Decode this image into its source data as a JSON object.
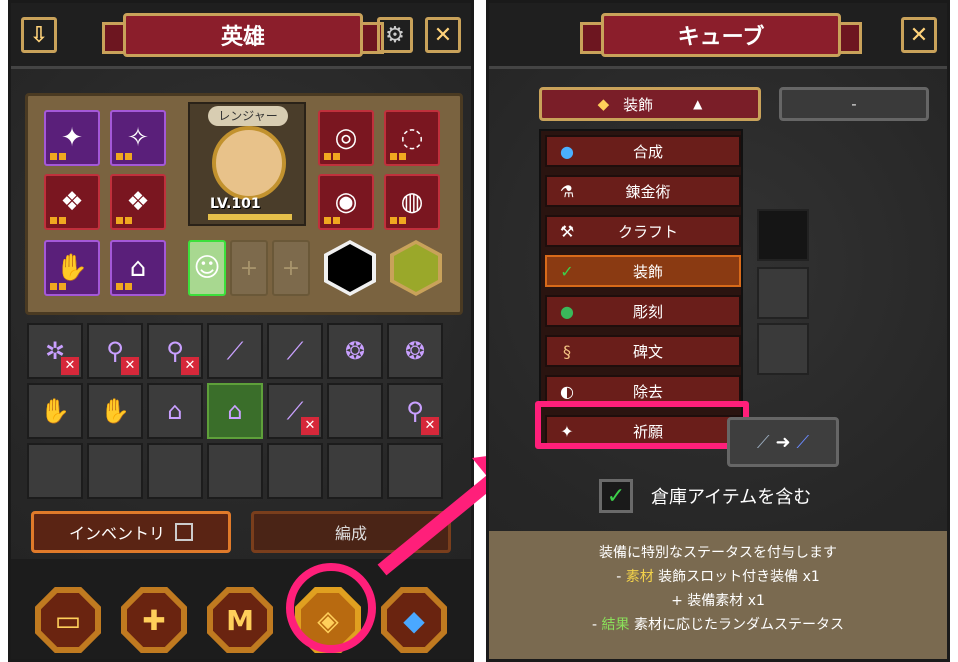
{
  "left_panel": {
    "title": "英雄",
    "hero": {
      "class_label": "レンジャー",
      "level": "LV.101"
    },
    "tabs": {
      "inventory": "インベントリ",
      "formation": "編成"
    },
    "bottom_nav": [
      {
        "id": "chest",
        "icon": "chest-icon",
        "glyph": "▭"
      },
      {
        "id": "cross",
        "icon": "cross-icon",
        "glyph": "✚"
      },
      {
        "id": "rune",
        "icon": "rune-icon",
        "glyph": "M"
      },
      {
        "id": "cube",
        "icon": "cube-icon",
        "glyph": "◈"
      },
      {
        "id": "gem",
        "icon": "gem-icon",
        "glyph": "◆"
      }
    ]
  },
  "right_panel": {
    "title": "キューブ",
    "dropdown": {
      "selected": "装飾",
      "other": "-"
    },
    "menu_items": [
      {
        "label": "合成",
        "icon": "●"
      },
      {
        "label": "錬金術",
        "icon": "⚗"
      },
      {
        "label": "クラフト",
        "icon": "⚒"
      },
      {
        "label": "装飾",
        "icon": "✓"
      },
      {
        "label": "彫刻",
        "icon": "●"
      },
      {
        "label": "碑文",
        "icon": "§"
      },
      {
        "label": "除去",
        "icon": "◐"
      },
      {
        "label": "祈願",
        "icon": "✦"
      }
    ],
    "checkbox_label": "倉庫アイテムを含む",
    "description": {
      "line1": "装備に特別なステータスを付与します",
      "line2_prefix": "- ",
      "line2_key": "素材",
      "line2_rest": " 装飾スロット付き装備 x1",
      "line3": "+ 装備素材 x1",
      "line4_prefix": "- ",
      "line4_key": "結果",
      "line4_rest": " 素材に応じたランダムステータス"
    }
  },
  "colors": {
    "accent_pink": "#ff1f7a",
    "title_red": "#8b1e2b",
    "gold_border": "#c9a25a"
  }
}
